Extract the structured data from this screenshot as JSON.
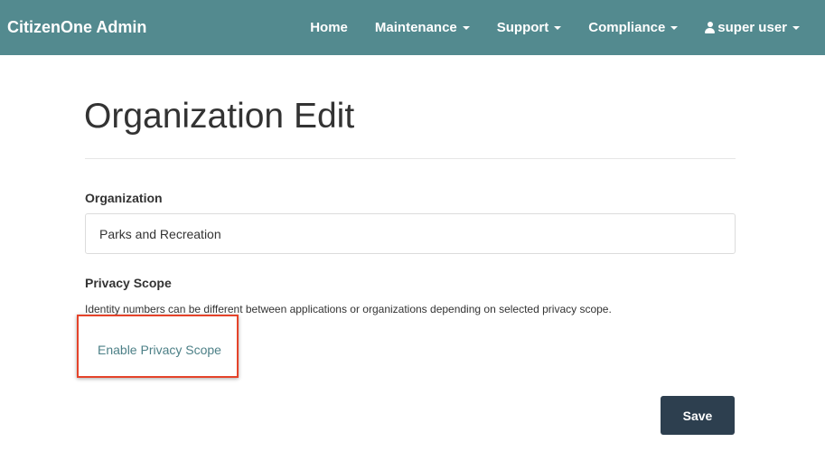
{
  "navbar": {
    "brand": "CitizenOne Admin",
    "items": [
      {
        "label": "Home",
        "dropdown": false
      },
      {
        "label": "Maintenance",
        "dropdown": true
      },
      {
        "label": "Support",
        "dropdown": true
      },
      {
        "label": "Compliance",
        "dropdown": true
      }
    ],
    "user": {
      "label": "super user",
      "icon": "user-icon",
      "dropdown": true
    }
  },
  "page": {
    "title": "Organization Edit"
  },
  "form": {
    "organization": {
      "label": "Organization",
      "value": "Parks and Recreation"
    },
    "privacy_scope": {
      "label": "Privacy Scope",
      "help": "Identity numbers can be different between applications or organizations depending on selected privacy scope.",
      "enable_link": "Enable Privacy Scope"
    },
    "save_label": "Save"
  },
  "colors": {
    "navbar": "#538a8f",
    "link": "#4d8087",
    "button": "#2d3f4f",
    "highlight": "#e5432a"
  }
}
